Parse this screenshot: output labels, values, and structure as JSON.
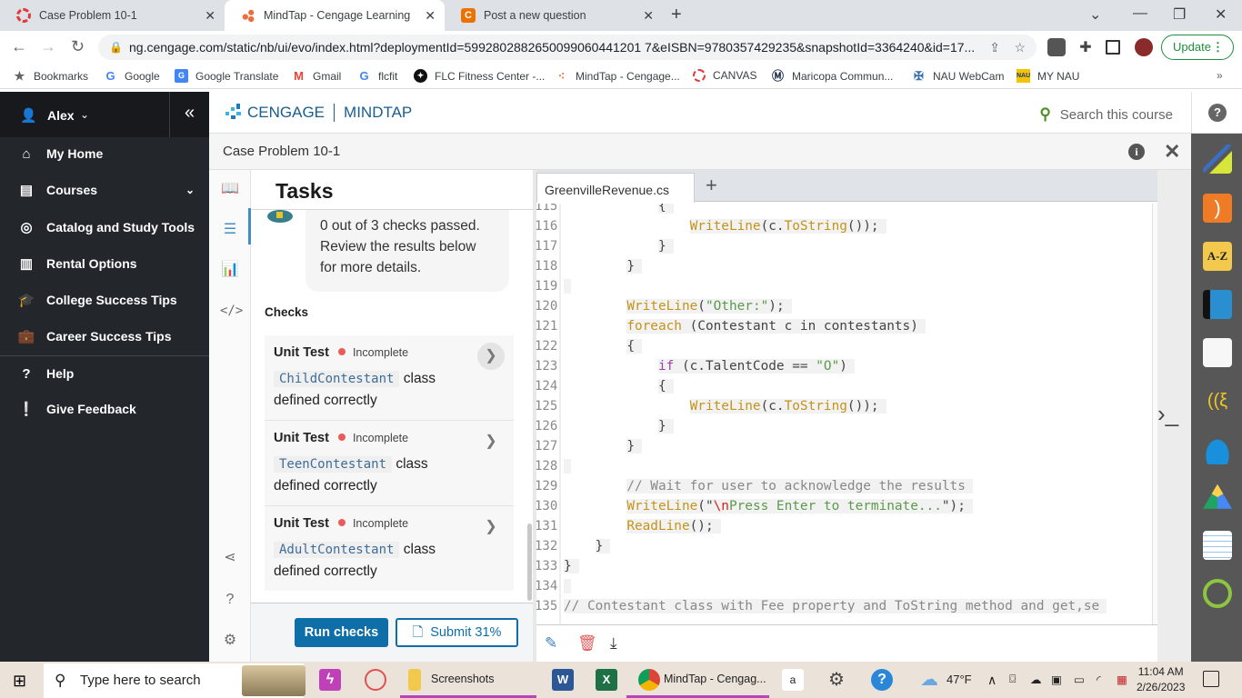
{
  "browser": {
    "tabs": [
      {
        "title": "Case Problem 10-1",
        "active": false
      },
      {
        "title": "MindTap - Cengage Learning",
        "active": true
      },
      {
        "title": "Post a new question",
        "active": false
      }
    ],
    "url": "ng.cengage.com/static/nb/ui/evo/index.html?deploymentId=5992802882650099060441201 7&eISBN=9780357429235&snapshotId=3364240&id=17...",
    "update_label": "Update",
    "bookmarks": [
      {
        "label": "Bookmarks",
        "icon": "star-icon"
      },
      {
        "label": "Google",
        "icon": "google-icon"
      },
      {
        "label": "Google Translate",
        "icon": "google-translate-icon"
      },
      {
        "label": "Gmail",
        "icon": "gmail-icon"
      },
      {
        "label": "flcfit",
        "icon": "google-icon"
      },
      {
        "label": "FLC Fitness Center -...",
        "icon": "fitness-icon"
      },
      {
        "label": "MindTap - Cengage...",
        "icon": "mindtap-icon"
      },
      {
        "label": "CANVAS",
        "icon": "canvas-icon"
      },
      {
        "label": "Maricopa Commun...",
        "icon": "maricopa-icon"
      },
      {
        "label": "NAU WebCam",
        "icon": "nau-icon"
      },
      {
        "label": "MY NAU",
        "icon": "mynau-icon"
      }
    ]
  },
  "nav": {
    "user": "Alex",
    "items": [
      {
        "label": "My Home",
        "icon": "home-icon"
      },
      {
        "label": "Courses",
        "icon": "book-icon"
      },
      {
        "label": "Catalog and Study Tools",
        "icon": "compass-icon"
      },
      {
        "label": "Rental Options",
        "icon": "open-book-icon"
      },
      {
        "label": "College Success Tips",
        "icon": "graduation-cap-icon"
      },
      {
        "label": "Career Success Tips",
        "icon": "briefcase-icon"
      },
      {
        "label": "Help",
        "icon": "help-icon"
      },
      {
        "label": "Give Feedback",
        "icon": "feedback-icon"
      }
    ]
  },
  "header": {
    "brand": "CENGAGE",
    "product": "MINDTAP",
    "search_placeholder": "Search this course",
    "activity_title": "Case Problem 10-1"
  },
  "tasks": {
    "title": "Tasks",
    "summary": "0 out of 3 checks passed. Review the results below for more details.",
    "checks_label": "Checks",
    "checks": [
      {
        "type": "Unit Test",
        "status": "Incomplete",
        "code": "ChildContestant",
        "text1": " class",
        "text2": "defined correctly"
      },
      {
        "type": "Unit Test",
        "status": "Incomplete",
        "code": "TeenContestant",
        "text1": " class",
        "text2": "defined correctly"
      },
      {
        "type": "Unit Test",
        "status": "Incomplete",
        "code": "AdultContestant",
        "text1": " class",
        "text2": "defined correctly"
      }
    ],
    "run_label": "Run checks",
    "submit_label": "Submit 31%"
  },
  "editor": {
    "filename": "GreenvilleRevenue.cs",
    "lines": [
      {
        "n": "115",
        "indent": "            ",
        "parts": [
          {
            "t": "{",
            "c": ""
          }
        ]
      },
      {
        "n": "116",
        "indent": "                ",
        "parts": [
          {
            "t": "WriteLine",
            "c": "kw"
          },
          {
            "t": "(c.",
            "c": ""
          },
          {
            "t": "ToString",
            "c": "kw"
          },
          {
            "t": "());",
            "c": ""
          }
        ]
      },
      {
        "n": "117",
        "indent": "            ",
        "parts": [
          {
            "t": "}",
            "c": ""
          }
        ]
      },
      {
        "n": "118",
        "indent": "        ",
        "parts": [
          {
            "t": "}",
            "c": ""
          }
        ]
      },
      {
        "n": "119",
        "indent": "",
        "parts": [
          {
            "t": "",
            "c": ""
          }
        ]
      },
      {
        "n": "120",
        "indent": "        ",
        "parts": [
          {
            "t": "WriteLine",
            "c": "kw"
          },
          {
            "t": "(",
            "c": ""
          },
          {
            "t": "\"Other:\"",
            "c": "str"
          },
          {
            "t": ");",
            "c": ""
          }
        ]
      },
      {
        "n": "121",
        "indent": "        ",
        "parts": [
          {
            "t": "foreach",
            "c": "kw"
          },
          {
            "t": " (Contestant c in contestants)",
            "c": ""
          }
        ]
      },
      {
        "n": "122",
        "indent": "        ",
        "parts": [
          {
            "t": "{",
            "c": ""
          }
        ]
      },
      {
        "n": "123",
        "indent": "            ",
        "parts": [
          {
            "t": "if",
            "c": "kw2"
          },
          {
            "t": " (c.TalentCode == ",
            "c": ""
          },
          {
            "t": "\"O\"",
            "c": "str"
          },
          {
            "t": ")",
            "c": ""
          }
        ]
      },
      {
        "n": "124",
        "indent": "            ",
        "parts": [
          {
            "t": "{",
            "c": ""
          }
        ]
      },
      {
        "n": "125",
        "indent": "                ",
        "parts": [
          {
            "t": "WriteLine",
            "c": "kw"
          },
          {
            "t": "(c.",
            "c": ""
          },
          {
            "t": "ToString",
            "c": "kw"
          },
          {
            "t": "());",
            "c": ""
          }
        ]
      },
      {
        "n": "126",
        "indent": "            ",
        "parts": [
          {
            "t": "}",
            "c": ""
          }
        ]
      },
      {
        "n": "127",
        "indent": "        ",
        "parts": [
          {
            "t": "}",
            "c": ""
          }
        ]
      },
      {
        "n": "128",
        "indent": "",
        "parts": [
          {
            "t": "",
            "c": ""
          }
        ]
      },
      {
        "n": "129",
        "indent": "        ",
        "parts": [
          {
            "t": "// Wait for user to acknowledge the results",
            "c": "cm"
          }
        ]
      },
      {
        "n": "130",
        "indent": "        ",
        "parts": [
          {
            "t": "WriteLine",
            "c": "kw"
          },
          {
            "t": "(\"",
            "c": ""
          },
          {
            "t": "\\n",
            "c": "esc"
          },
          {
            "t": "Press Enter to terminate...",
            "c": "str"
          },
          {
            "t": "\");",
            "c": ""
          }
        ]
      },
      {
        "n": "131",
        "indent": "        ",
        "parts": [
          {
            "t": "ReadLine",
            "c": "kw"
          },
          {
            "t": "();",
            "c": ""
          }
        ]
      },
      {
        "n": "132",
        "indent": "    ",
        "parts": [
          {
            "t": "}",
            "c": ""
          }
        ]
      },
      {
        "n": "133",
        "indent": "",
        "parts": [
          {
            "t": "}",
            "c": ""
          }
        ]
      },
      {
        "n": "134",
        "indent": "",
        "parts": [
          {
            "t": "",
            "c": ""
          }
        ]
      },
      {
        "n": "135",
        "indent": "",
        "parts": [
          {
            "t": "// Contestant class with Fee property and ToString method and get,se",
            "c": "cm"
          }
        ]
      }
    ]
  },
  "taskbar": {
    "search_placeholder": "Type here to search",
    "screenshots_label": "Screenshots",
    "chrome_label": "MindTap - Cengag...",
    "weather": "47°F",
    "time": "11:04 AM",
    "date": "2/26/2023"
  }
}
